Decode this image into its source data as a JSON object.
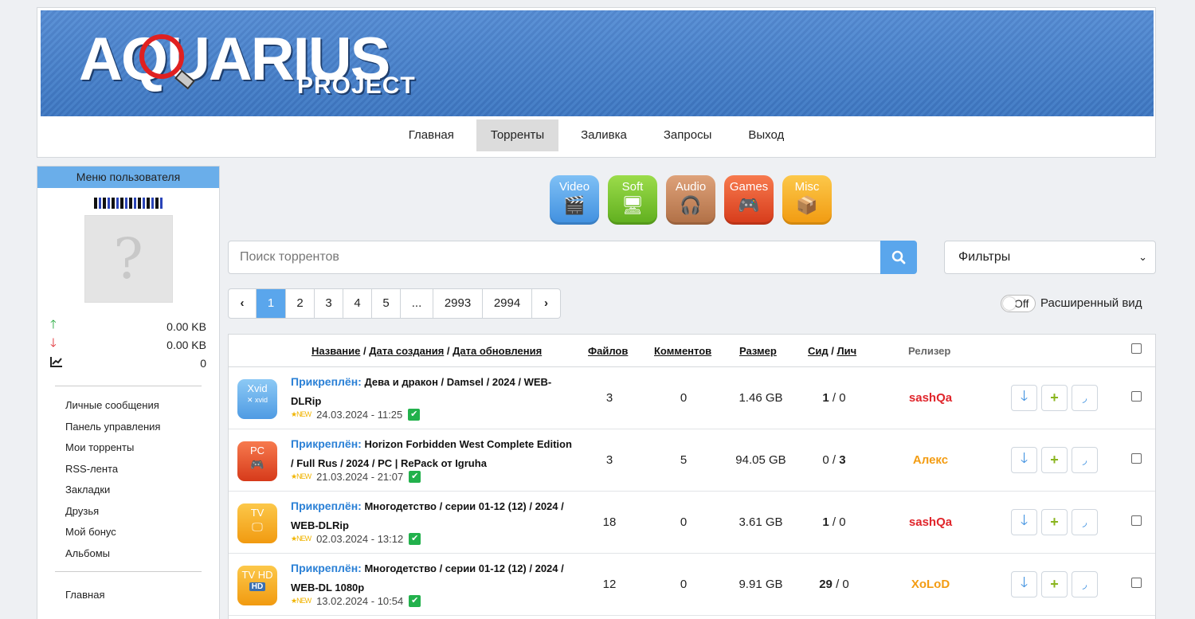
{
  "header": {
    "logo_main": "AQUARIUS",
    "logo_sub": "PROJECT"
  },
  "nav": [
    {
      "label": "Главная",
      "active": false
    },
    {
      "label": "Торренты",
      "active": true
    },
    {
      "label": "Заливка",
      "active": false
    },
    {
      "label": "Запросы",
      "active": false
    },
    {
      "label": "Выход",
      "active": false
    }
  ],
  "sidebar": {
    "title": "Меню пользователя",
    "avatar_placeholder": "?",
    "stats": {
      "uploaded": "0.00 KB",
      "downloaded": "0.00 KB",
      "ratio": "0"
    },
    "links": [
      "Личные сообщения",
      "Панель управления",
      "Мои торренты",
      "RSS-лента",
      "Закладки",
      "Друзья",
      "Мой бонус",
      "Альбомы"
    ],
    "links2": [
      "Главная"
    ]
  },
  "categories": [
    {
      "label": "Video",
      "icon": "clapperboard-icon",
      "color": "#5ea8ea"
    },
    {
      "label": "Soft",
      "icon": "monitor-gear-icon",
      "color": "#7cc832"
    },
    {
      "label": "Audio",
      "icon": "headphones-icon",
      "color": "#c8895e"
    },
    {
      "label": "Games",
      "icon": "gamepad-icon",
      "color": "#ee5530"
    },
    {
      "label": "Misc",
      "icon": "box-icon",
      "color": "#f7b21e"
    }
  ],
  "search": {
    "placeholder": "Поиск торрентов",
    "filters_label": "Фильтры"
  },
  "pagination": {
    "prev": "‹",
    "pages": [
      "1",
      "2",
      "3",
      "4",
      "5",
      "...",
      "2993",
      "2994"
    ],
    "current": "1",
    "next": "›"
  },
  "view_toggle": {
    "state": "Off",
    "label": "Расширенный вид"
  },
  "table": {
    "headers": {
      "name": "Название",
      "sep1": " / ",
      "created": "Дата создания",
      "sep2": " / ",
      "updated": "Дата обновления",
      "files": "Файлов",
      "comments": "Комментов",
      "size": "Размер",
      "seeds": "Сид",
      "sep3": " / ",
      "leech": "Лич",
      "releaser": "Релизер"
    },
    "rows": [
      {
        "type_label": "Xvid",
        "type_sub": "✕ xvid",
        "type_color": "#5ea8ea",
        "pin": "Прикреплён:",
        "title": "Дева и дракон / Damsel / 2024 / WEB-DLRip",
        "stars": "★NEW",
        "date": "24.03.2024 - 11:25",
        "files": "3",
        "comments": "0",
        "size": "1.46 GB",
        "seeds": "1",
        "leech": "0",
        "releaser": "sashQa",
        "releaser_color": "#e0252b"
      },
      {
        "type_label": "PC",
        "type_sub": "🎮",
        "type_color": "#ee5530",
        "pin": "Прикреплён:",
        "title": "Horizon Forbidden West Complete Edition / Full Rus / 2024 / PC | RePack от Igruha",
        "stars": "★NEW",
        "date": "21.03.2024 - 21:07",
        "files": "3",
        "comments": "5",
        "size": "94.05 GB",
        "seeds": "0",
        "leech": "3",
        "releaser": "Алекс",
        "releaser_color": "#f39c12"
      },
      {
        "type_label": "TV",
        "type_sub": "🖵",
        "type_color": "#f7b21e",
        "pin": "Прикреплён:",
        "title": "Многодетство / серии 01-12 (12) / 2024 / WEB-DLRip",
        "stars": "★NEW",
        "date": "02.03.2024 - 13:12",
        "files": "18",
        "comments": "0",
        "size": "3.61 GB",
        "seeds": "1",
        "leech": "0",
        "releaser": "sashQa",
        "releaser_color": "#e0252b"
      },
      {
        "type_label": "TV HD",
        "type_sub": "HD",
        "type_color": "#f7b21e",
        "pin": "Прикреплён:",
        "title": "Многодетство / серии 01-12 (12) / 2024 / WEB-DL 1080p",
        "stars": "★NEW",
        "date": "13.02.2024 - 10:54",
        "files": "12",
        "comments": "0",
        "size": "9.91 GB",
        "seeds": "29",
        "leech": "0",
        "releaser": "XoLoD",
        "releaser_color": "#f39c12"
      }
    ]
  }
}
